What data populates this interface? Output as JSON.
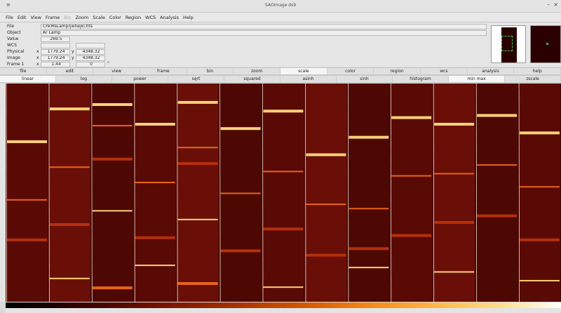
{
  "window": {
    "title": "SAOImage ds9",
    "menu_glyph": "≡",
    "min_glyph": "–",
    "close_glyph": "×"
  },
  "menubar": {
    "items": [
      "File",
      "Edit",
      "View",
      "Frame",
      "Bin",
      "Zoom",
      "Scale",
      "Color",
      "Region",
      "WCS",
      "Analysis",
      "Help"
    ]
  },
  "info": {
    "file_label": "File",
    "file_value": "ChkMsLamprjwhejkl.fits",
    "object_label": "Object",
    "object_value": "Ar Lamp",
    "value_label": "Value",
    "value_value": "269.5",
    "wcs_label": "WCS",
    "physical_label": "Physical",
    "physical_x": "1779.24",
    "physical_y": "4348.32",
    "image_label": "Image",
    "image_x": "1779.24",
    "image_y": "4348.32",
    "frame_label": "Frame 1",
    "frame_zoom": "1.44",
    "frame_angle": "0",
    "degree_glyph": "°",
    "x_label": "x",
    "y_label": "y"
  },
  "buttonbar": {
    "main": [
      "file",
      "edit",
      "view",
      "frame",
      "bin",
      "zoom",
      "scale",
      "color",
      "region",
      "wcs",
      "analysis",
      "help"
    ],
    "main_active": 6,
    "scale": [
      "linear",
      "log",
      "power",
      "sqrt",
      "squared",
      "asinh",
      "sinh",
      "histogram",
      "min max",
      "zscale"
    ],
    "scale_active": [
      0,
      8
    ]
  },
  "colors": {
    "frame_bg": "#3a0503",
    "accent_green": "#3cd33c"
  },
  "image": {
    "strips": [
      {
        "lines": [
          0.26,
          0.53,
          0.71
        ]
      },
      {
        "lines": [
          0.11,
          0.38,
          0.64,
          0.89
        ]
      },
      {
        "lines": [
          0.09,
          0.19,
          0.34,
          0.58,
          0.93
        ]
      },
      {
        "lines": [
          0.18,
          0.45,
          0.7,
          0.83
        ]
      },
      {
        "lines": [
          0.08,
          0.29,
          0.36,
          0.62,
          0.91
        ]
      },
      {
        "lines": [
          0.2,
          0.5,
          0.76
        ]
      },
      {
        "lines": [
          0.12,
          0.4,
          0.66,
          0.93
        ]
      },
      {
        "lines": [
          0.32,
          0.55,
          0.78
        ]
      },
      {
        "lines": [
          0.24,
          0.57,
          0.75,
          0.84
        ]
      },
      {
        "lines": [
          0.15,
          0.42,
          0.69
        ]
      },
      {
        "lines": [
          0.18,
          0.41,
          0.63,
          0.86
        ]
      },
      {
        "lines": [
          0.14,
          0.37,
          0.6
        ]
      },
      {
        "lines": [
          0.22,
          0.47,
          0.71,
          0.9
        ]
      }
    ]
  }
}
